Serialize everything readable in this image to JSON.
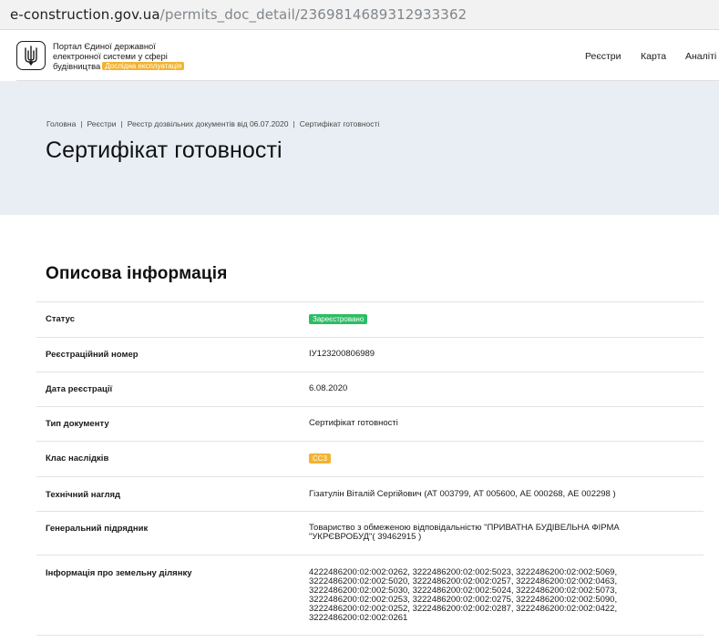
{
  "browser": {
    "url_host": "e-construction.gov.ua",
    "url_path": "/permits_doc_detail/2369814689312933362"
  },
  "header": {
    "logo_icon": "trident-icon",
    "brand_line1": "Портал Єдиної державної",
    "brand_line2": "електронної системи у сфері",
    "brand_line3": "будівництва",
    "beta_badge": "Дослідна експлуатація",
    "nav": {
      "registers": "Реєстри",
      "map": "Карта",
      "analytics": "Аналіті"
    }
  },
  "breadcrumb": {
    "items": [
      "Головна",
      "Реєстри",
      "Реєстр дозвільних документів від 06.07.2020",
      "Сертифікат готовності"
    ]
  },
  "page": {
    "title": "Сертифікат готовності",
    "section_title": "Описова інформація"
  },
  "rows": {
    "status": {
      "label": "Статус",
      "value": "Зареєстровано",
      "color": "#2dbd66"
    },
    "reg_number": {
      "label": "Реєстраційний номер",
      "value": "ІУ123200806989"
    },
    "reg_date": {
      "label": "Дата реєстрації",
      "value": "6.08.2020"
    },
    "doc_type": {
      "label": "Тип документу",
      "value": "Сертифікат готовності"
    },
    "consequence_class": {
      "label": "Клас наслідків",
      "value": "СС3",
      "color": "#f2b331"
    },
    "tech_supervision": {
      "label": "Технічний нагляд",
      "value": "Гізатулін Віталій Сергійович (АТ 003799, АТ 005600, АЕ 000268, АЕ 002298 )"
    },
    "general_contractor": {
      "label": "Генеральний підрядник",
      "value_line1": "Товариство з обмеженою відповідальністю \"ПРИВАТНА БУДІВЕЛЬНА ФІРМА",
      "value_line2": "\"УКРЄВРОБУД\"( 39462915 )"
    },
    "land_plot": {
      "label": "Інформація про земельну ділянку",
      "lines": [
        "4222486200:02:002:0262, 3222486200:02:002:5023, 3222486200:02:002:5069,",
        "3222486200:02:002:5020, 3222486200:02:002:0257, 3222486200:02:002:0463,",
        "3222486200:02:002:5030, 3222486200:02:002:5024, 3222486200:02:002:5073,",
        "3222486200:02:002:0253, 3222486200:02:002:0275, 3222486200:02:002:5090,",
        "3222486200:02:002:0252, 3222486200:02:002:0287, 3222486200:02:002:0422,",
        "3222486200:02:002:0261"
      ]
    }
  }
}
